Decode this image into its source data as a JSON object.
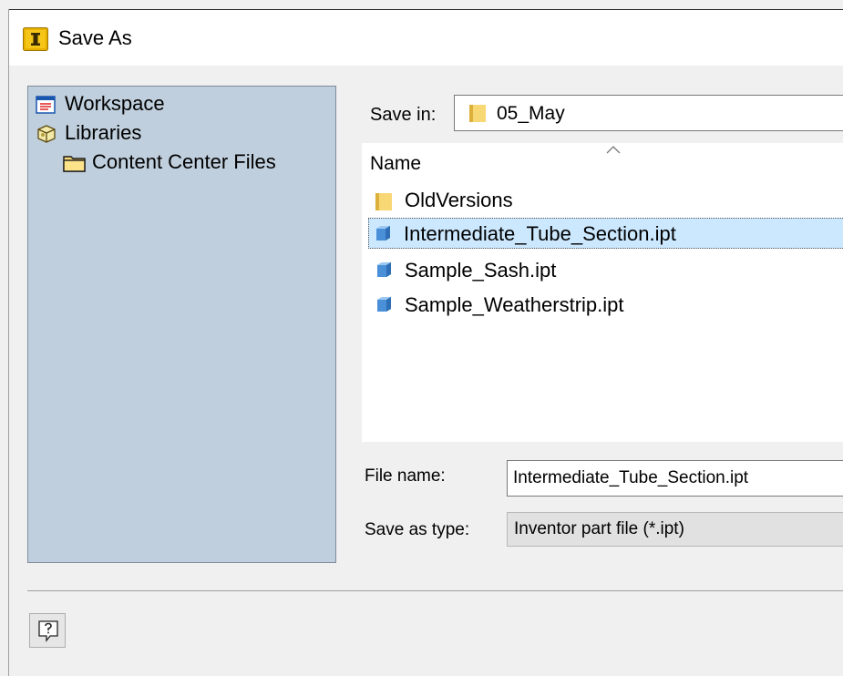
{
  "window": {
    "title": "Save As"
  },
  "sidebar": {
    "items": [
      {
        "label": "Workspace",
        "icon": "workspace-icon"
      },
      {
        "label": "Libraries",
        "icon": "libraries-icon"
      },
      {
        "label": "Content Center Files",
        "icon": "folder-icon"
      }
    ]
  },
  "save_in": {
    "label": "Save in:",
    "value": "05_May"
  },
  "file_list": {
    "column_header": "Name",
    "items": [
      {
        "name": "OldVersions",
        "icon": "folder-icon",
        "selected": false
      },
      {
        "name": "Intermediate_Tube_Section.ipt",
        "icon": "part-file-icon",
        "selected": true
      },
      {
        "name": "Sample_Sash.ipt",
        "icon": "part-file-icon",
        "selected": false
      },
      {
        "name": "Sample_Weatherstrip.ipt",
        "icon": "part-file-icon",
        "selected": false
      }
    ]
  },
  "file_name": {
    "label": "File name:",
    "value": "Intermediate_Tube_Section.ipt"
  },
  "save_as_type": {
    "label": "Save as type:",
    "value": "Inventor part file (*.ipt)"
  },
  "colors": {
    "sidebar_bg": "#c0cfdd",
    "selection_bg": "#cce8ff",
    "folder": "#f8d775",
    "part_file": "#4a90d9",
    "app_icon": "#e8b100"
  }
}
